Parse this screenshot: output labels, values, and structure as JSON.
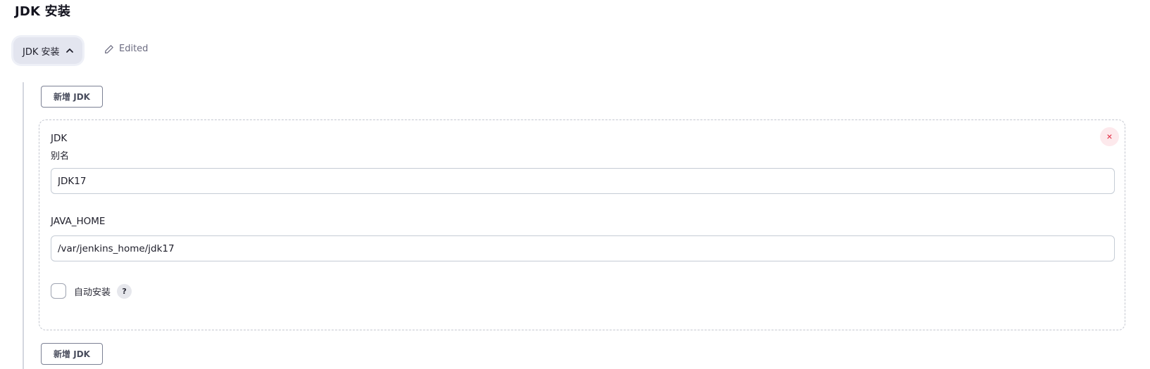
{
  "section": {
    "title": "JDK 安装"
  },
  "toggle": {
    "label": "JDK 安装",
    "icon": "chevron-up-icon"
  },
  "status": {
    "text": "Edited",
    "icon": "pencil-icon"
  },
  "add_button_label": "新增 JDK",
  "jdk_entry": {
    "type_label": "JDK",
    "alias_label": "别名",
    "alias_value": "JDK17",
    "java_home_label": "JAVA_HOME",
    "java_home_value": "/var/jenkins_home/jdk17",
    "auto_install_label": "自动安装",
    "auto_install_checked": false,
    "help_text": "?",
    "delete_icon_text": "×"
  },
  "colors": {
    "delete_accent": "#e0233b",
    "border": "#c5ccd5"
  }
}
